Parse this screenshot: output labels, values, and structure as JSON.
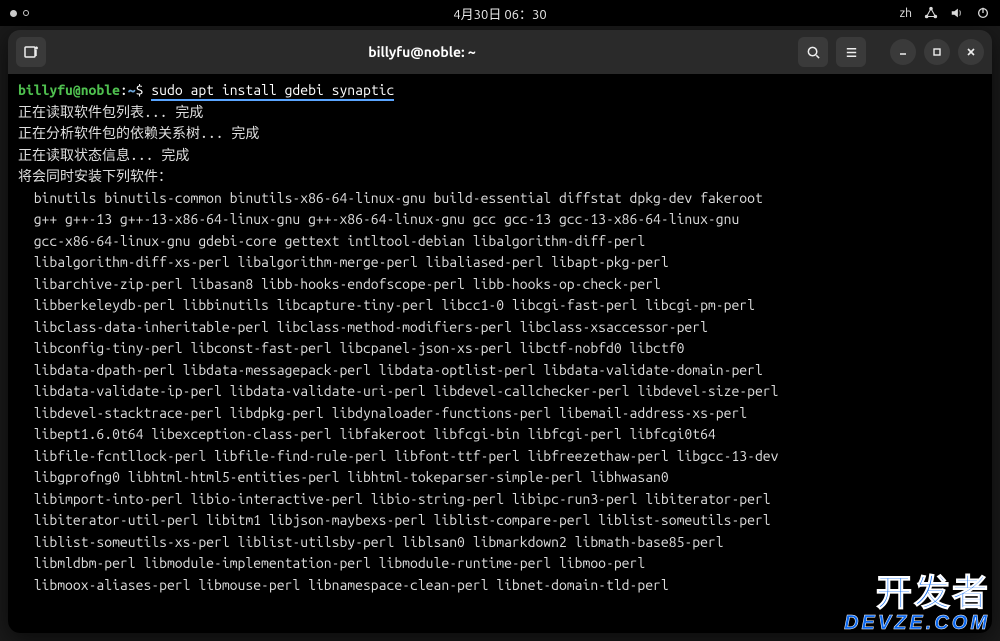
{
  "topbar": {
    "datetime": "4月30日 06：30",
    "input_method": "zh"
  },
  "window": {
    "title": "billyfu@noble: ~"
  },
  "prompt": {
    "user": "billyfu",
    "host": "noble",
    "path": "~",
    "symbol": "$"
  },
  "command": "sudo apt install gdebi synaptic",
  "status_lines": [
    "正在读取软件包列表... 完成",
    "正在分析软件包的依赖关系树... 完成",
    "正在读取状态信息... 完成",
    "将会同时安装下列软件："
  ],
  "package_lines": [
    "binutils binutils-common binutils-x86-64-linux-gnu build-essential diffstat dpkg-dev fakeroot",
    "g++ g++-13 g++-13-x86-64-linux-gnu g++-x86-64-linux-gnu gcc gcc-13 gcc-13-x86-64-linux-gnu",
    "gcc-x86-64-linux-gnu gdebi-core gettext intltool-debian libalgorithm-diff-perl",
    "libalgorithm-diff-xs-perl libalgorithm-merge-perl libaliased-perl libapt-pkg-perl",
    "libarchive-zip-perl libasan8 libb-hooks-endofscope-perl libb-hooks-op-check-perl",
    "libberkeleydb-perl libbinutils libcapture-tiny-perl libcc1-0 libcgi-fast-perl libcgi-pm-perl",
    "libclass-data-inheritable-perl libclass-method-modifiers-perl libclass-xsaccessor-perl",
    "libconfig-tiny-perl libconst-fast-perl libcpanel-json-xs-perl libctf-nobfd0 libctf0",
    "libdata-dpath-perl libdata-messagepack-perl libdata-optlist-perl libdata-validate-domain-perl",
    "libdata-validate-ip-perl libdata-validate-uri-perl libdevel-callchecker-perl libdevel-size-perl",
    "libdevel-stacktrace-perl libdpkg-perl libdynaloader-functions-perl libemail-address-xs-perl",
    "libept1.6.0t64 libexception-class-perl libfakeroot libfcgi-bin libfcgi-perl libfcgi0t64",
    "libfile-fcntllock-perl libfile-find-rule-perl libfont-ttf-perl libfreezethaw-perl libgcc-13-dev",
    "libgprofng0 libhtml-html5-entities-perl libhtml-tokeparser-simple-perl libhwasan0",
    "libimport-into-perl libio-interactive-perl libio-string-perl libipc-run3-perl libiterator-perl",
    "libiterator-util-perl libitm1 libjson-maybexs-perl liblist-compare-perl liblist-someutils-perl",
    "liblist-someutils-xs-perl liblist-utilsby-perl liblsan0 libmarkdown2 libmath-base85-perl",
    "libmldbm-perl libmodule-implementation-perl libmodule-runtime-perl libmoo-perl",
    "libmoox-aliases-perl libmouse-perl libnamespace-clean-perl libnet-domain-tld-perl"
  ],
  "watermark": {
    "line1": "开发者",
    "line2": "DEVZE.COM"
  }
}
